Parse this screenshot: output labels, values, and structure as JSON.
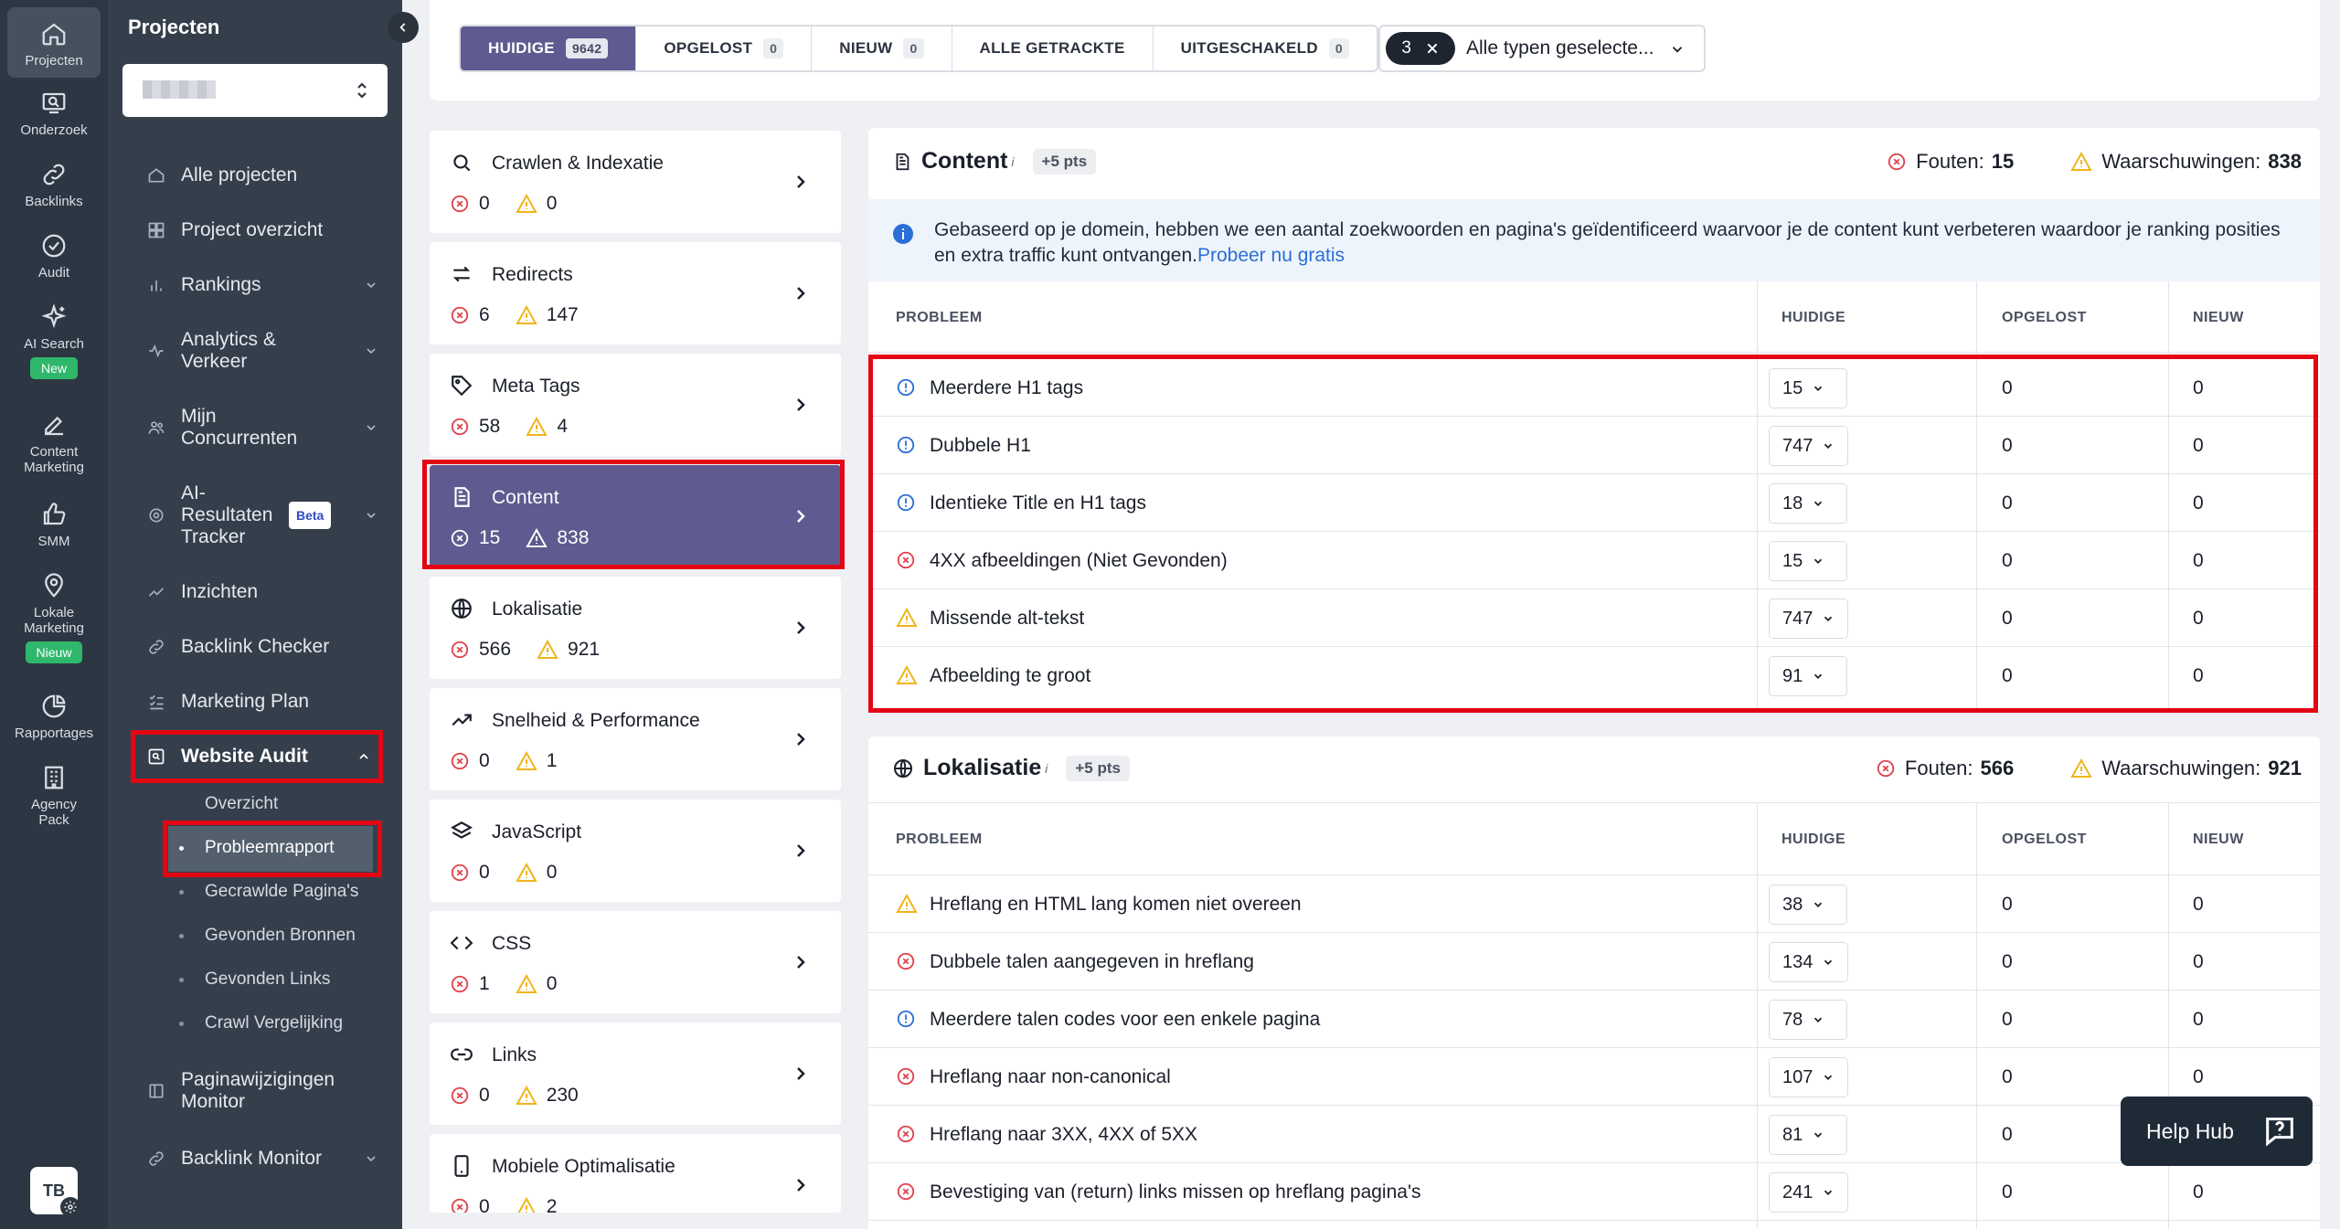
{
  "rail": {
    "items": [
      {
        "label": "Projecten",
        "icon": "home-icon"
      },
      {
        "label": "Onderzoek",
        "icon": "research-icon"
      },
      {
        "label": "Backlinks",
        "icon": "link-icon"
      },
      {
        "label": "Audit",
        "icon": "audit-check-icon"
      },
      {
        "label": "AI Search",
        "icon": "sparkle-icon",
        "badge": "New"
      },
      {
        "label": "Content Marketing",
        "icon": "edit-icon"
      },
      {
        "label": "SMM",
        "icon": "thumbs-up-icon"
      },
      {
        "label": "Lokale Marketing",
        "icon": "location-pin-icon",
        "badge": "Nieuw"
      },
      {
        "label": "Rapportages",
        "icon": "pie-chart-icon"
      },
      {
        "label": "Agency Pack",
        "icon": "building-icon"
      }
    ],
    "avatar": "TB"
  },
  "nav": {
    "title": "Projecten",
    "items": [
      {
        "label": "Alle projecten"
      },
      {
        "label": "Project overzicht"
      },
      {
        "label": "Rankings"
      },
      {
        "label": "Analytics & Verkeer"
      },
      {
        "label": "Mijn Concurrenten"
      },
      {
        "label": "AI-Resultaten Tracker",
        "badge": "Beta"
      },
      {
        "label": "Inzichten"
      },
      {
        "label": "Backlink Checker"
      },
      {
        "label": "Marketing Plan"
      },
      {
        "label": "Website Audit"
      },
      {
        "label": "Paginawijzigingen Monitor"
      },
      {
        "label": "Backlink Monitor"
      }
    ],
    "sub_items": [
      "Overzicht",
      "Probleemrapport",
      "Gecrawlde Pagina's",
      "Gevonden Bronnen",
      "Gevonden Links",
      "Crawl Vergelijking"
    ]
  },
  "filters": {
    "segments": [
      {
        "label": "HUIDIGE",
        "count": "9642"
      },
      {
        "label": "OPGELOST",
        "count": "0"
      },
      {
        "label": "NIEUW",
        "count": "0"
      },
      {
        "label": "ALLE GETRACKTE",
        "count": ""
      },
      {
        "label": "UITGESCHAKELD",
        "count": "0"
      }
    ],
    "type_count": "3",
    "type_label": "Alle typen geselecte..."
  },
  "categories": [
    {
      "name": "Crawlen & Indexatie",
      "errors": "0",
      "warnings": "0"
    },
    {
      "name": "Redirects",
      "errors": "6",
      "warnings": "147"
    },
    {
      "name": "Meta Tags",
      "errors": "58",
      "warnings": "4"
    },
    {
      "name": "Content",
      "errors": "15",
      "warnings": "838"
    },
    {
      "name": "Lokalisatie",
      "errors": "566",
      "warnings": "921"
    },
    {
      "name": "Snelheid & Performance",
      "errors": "0",
      "warnings": "1"
    },
    {
      "name": "JavaScript",
      "errors": "0",
      "warnings": "0"
    },
    {
      "name": "CSS",
      "errors": "1",
      "warnings": "0"
    },
    {
      "name": "Links",
      "errors": "0",
      "warnings": "230"
    },
    {
      "name": "Mobiele Optimalisatie",
      "errors": "0",
      "warnings": "2"
    }
  ],
  "content_panel": {
    "title": "Content",
    "info_sup": "i",
    "pts": "+5 pts",
    "errors_label": "Fouten:",
    "errors": "15",
    "warnings_label": "Waarschuwingen:",
    "warnings": "838",
    "info_text": "Gebaseerd op je domein, hebben we een aantal zoekwoorden en pagina's geïdentificeerd waarvoor je de content kunt verbeteren waardoor je ranking posities en extra traffic kunt ontvangen.",
    "info_link": "Probeer nu gratis",
    "columns": [
      "PROBLEEM",
      "HUIDIGE",
      "OPGELOST",
      "NIEUW"
    ],
    "rows": [
      {
        "type": "notice",
        "name": "Meerdere H1 tags",
        "current": "15",
        "resolved": "0",
        "new": "0"
      },
      {
        "type": "notice",
        "name": "Dubbele H1",
        "current": "747",
        "resolved": "0",
        "new": "0"
      },
      {
        "type": "notice",
        "name": "Identieke Title en H1 tags",
        "current": "18",
        "resolved": "0",
        "new": "0"
      },
      {
        "type": "error",
        "name": "4XX afbeeldingen (Niet Gevonden)",
        "current": "15",
        "resolved": "0",
        "new": "0"
      },
      {
        "type": "warning",
        "name": "Missende alt-tekst",
        "current": "747",
        "resolved": "0",
        "new": "0"
      },
      {
        "type": "warning",
        "name": "Afbeelding te groot",
        "current": "91",
        "resolved": "0",
        "new": "0"
      }
    ]
  },
  "loc_panel": {
    "title": "Lokalisatie",
    "info_sup": "i",
    "pts": "+5 pts",
    "errors_label": "Fouten:",
    "errors": "566",
    "warnings_label": "Waarschuwingen:",
    "warnings": "921",
    "columns": [
      "PROBLEEM",
      "HUIDIGE",
      "OPGELOST",
      "NIEUW"
    ],
    "rows": [
      {
        "type": "warning",
        "name": "Hreflang en HTML lang komen niet overeen",
        "current": "38",
        "resolved": "0",
        "new": "0"
      },
      {
        "type": "error",
        "name": "Dubbele talen aangegeven in hreflang",
        "current": "134",
        "resolved": "0",
        "new": "0"
      },
      {
        "type": "notice",
        "name": "Meerdere talen codes voor een enkele pagina",
        "current": "78",
        "resolved": "0",
        "new": "0"
      },
      {
        "type": "error",
        "name": "Hreflang naar non-canonical",
        "current": "107",
        "resolved": "0",
        "new": "0"
      },
      {
        "type": "error",
        "name": "Hreflang naar 3XX, 4XX of 5XX",
        "current": "81",
        "resolved": "0",
        "new": "0"
      },
      {
        "type": "error",
        "name": "Bevestiging van (return) links missen op hreflang pagina's",
        "current": "241",
        "resolved": "0",
        "new": "0"
      }
    ]
  },
  "help_hub": "Help Hub",
  "colors": {
    "accent": "#5f5a8f",
    "highlight": "#e40613",
    "error": "#e0424b",
    "warning": "#f0b41c",
    "notice": "#2a6fd6"
  }
}
